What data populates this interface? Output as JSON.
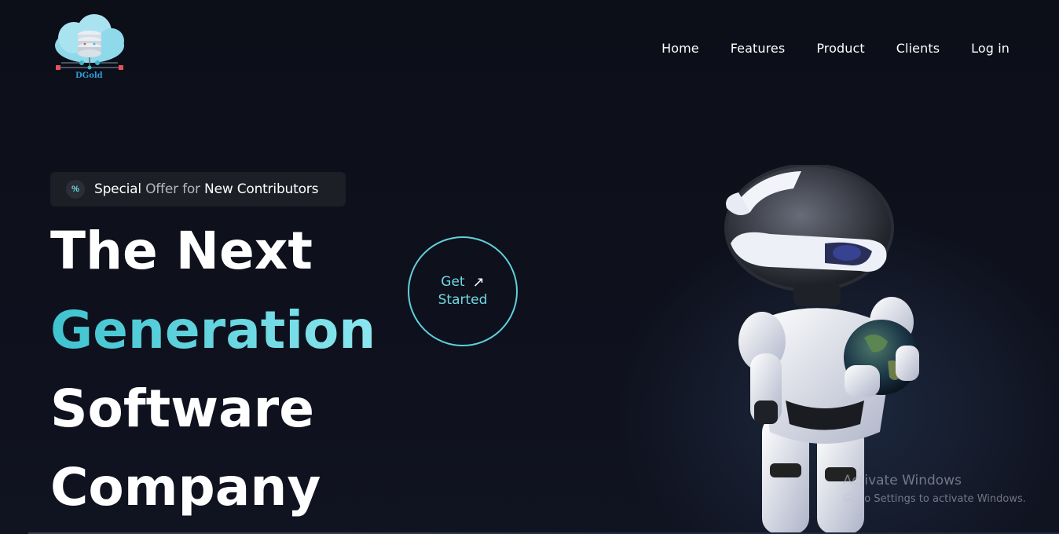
{
  "brand": {
    "logo_text": "DGold",
    "logo_icon": "cloud-database-icon",
    "colors": {
      "cloud": "#8fd9ea",
      "accent_red": "#e8505b",
      "brand_blue": "#2a9fd8"
    }
  },
  "nav": {
    "items": [
      {
        "label": "Home"
      },
      {
        "label": "Features"
      },
      {
        "label": "Product"
      },
      {
        "label": "Clients"
      },
      {
        "label": "Log in"
      }
    ]
  },
  "badge": {
    "icon": "percent-icon",
    "word1": "Special",
    "word2": " Offer for ",
    "word3": "New Contributors"
  },
  "hero": {
    "line1": "The Next",
    "line2": "Generation",
    "line3": "Software",
    "line4": "Company",
    "accent_colors": [
      "#3ec3cf",
      "#8be6ef"
    ]
  },
  "cta": {
    "line1": "Get",
    "line2": "Started",
    "icon": "arrow-up-right-icon",
    "arrow": "↗",
    "color": "#5fd0dc"
  },
  "illustration": {
    "name": "robot-holding-globe"
  },
  "watermark": {
    "title": "Activate Windows",
    "subtitle": "Go to Settings to activate Windows."
  }
}
